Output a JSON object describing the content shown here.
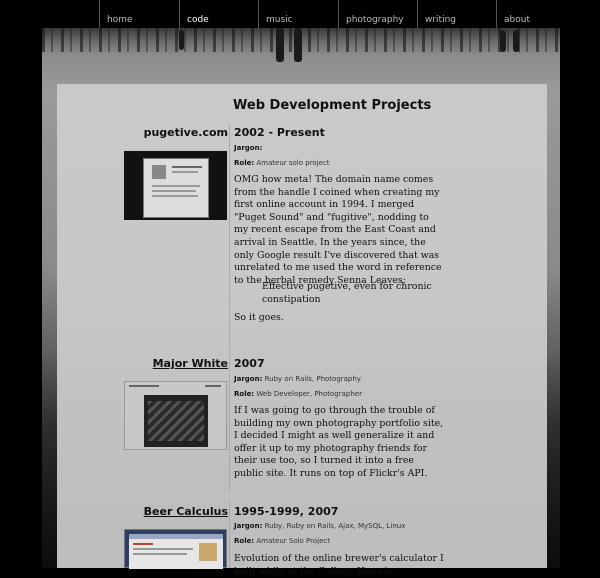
{
  "nav": {
    "items": [
      {
        "label": "home"
      },
      {
        "label": "code"
      },
      {
        "label": "music"
      },
      {
        "label": "photography"
      },
      {
        "label": "writing"
      },
      {
        "label": "about"
      }
    ],
    "active": "code"
  },
  "page": {
    "title": "Web Development Projects"
  },
  "projects": [
    {
      "name": "pugetive.com",
      "date": "2002 - Present",
      "jargon_label": "Jargon:",
      "jargon": "",
      "role_label": "Role:",
      "role": "Amateur solo project",
      "description": "OMG how meta! The domain name comes from the handle I coined when creating my first online account in 1994. I merged \"Puget Sound\" and \"fugitive\", nodding to my recent escape from the East Coast and arrival in Seattle. In the years since, the only Google result I've discovered that was unrelated to me used the word in reference to the herbal remedy Senna Leaves:",
      "quote": "Effective pugetive, even for chronic constipation",
      "closing": "So it goes."
    },
    {
      "name": "Major White",
      "date": "2007",
      "jargon_label": "Jargon:",
      "jargon": "Ruby on Rails, Photography",
      "role_label": "Role:",
      "role": "Web Developer, Photographer",
      "description": "If I was going to go through the trouble of building my own photography portfolio site, I decided I might as well generalize it and offer it up to my photography friends for their use too, so I turned it into a free public site. It runs on top of Flickr's API."
    },
    {
      "name": "Beer Calculus",
      "date": "1995-1999, 2007",
      "jargon_label": "Jargon:",
      "jargon": "Ruby, Ruby on Rails, Ajax, MySQL, Linux",
      "role_label": "Role:",
      "role": "Amateur Solo Project",
      "description": "Evolution of the online brewer's calculator I built while at the College Hops in..."
    }
  ]
}
